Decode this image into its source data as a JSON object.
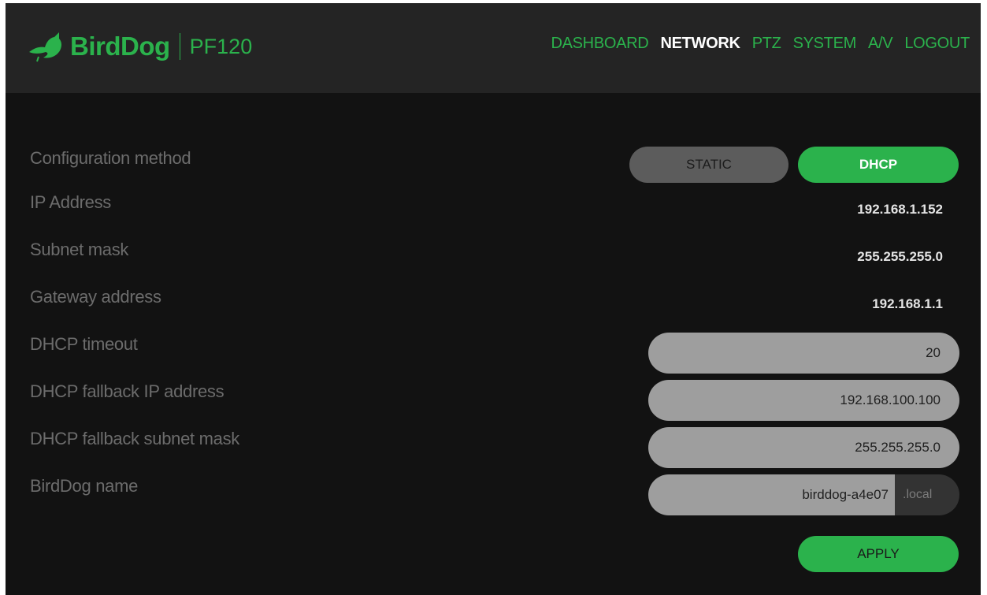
{
  "colors": {
    "accent": "#2bb24c",
    "header_bg": "#242424",
    "page_bg": "#121212",
    "field_bg": "#9e9e9e",
    "label": "#6c6c6c"
  },
  "header": {
    "logo_icon": "bird-icon",
    "brand_name": "BirdDog",
    "model": "PF120",
    "nav": [
      {
        "label": "DASHBOARD",
        "active": false
      },
      {
        "label": "NETWORK",
        "active": true
      },
      {
        "label": "PTZ",
        "active": false
      },
      {
        "label": "SYSTEM",
        "active": false
      },
      {
        "label": "A/V",
        "active": false
      },
      {
        "label": "LOGOUT",
        "active": false
      }
    ]
  },
  "network": {
    "configuration_method": {
      "label": "Configuration method",
      "options": [
        "STATIC",
        "DHCP"
      ],
      "selected": "DHCP"
    },
    "ip_address": {
      "label": "IP Address",
      "value": "192.168.1.152"
    },
    "subnet_mask": {
      "label": "Subnet mask",
      "value": "255.255.255.0"
    },
    "gateway_address": {
      "label": "Gateway address",
      "value": "192.168.1.1"
    },
    "dhcp_timeout": {
      "label": "DHCP timeout",
      "value": "20"
    },
    "dhcp_fallback_ip": {
      "label": "DHCP fallback IP address",
      "value": "192.168.100.100"
    },
    "dhcp_fallback_subnet": {
      "label": "DHCP fallback subnet mask",
      "value": "255.255.255.0"
    },
    "birddog_name": {
      "label": "BirdDog name",
      "value": "birddog-a4e07",
      "suffix": ".local"
    },
    "apply_label": "APPLY"
  }
}
